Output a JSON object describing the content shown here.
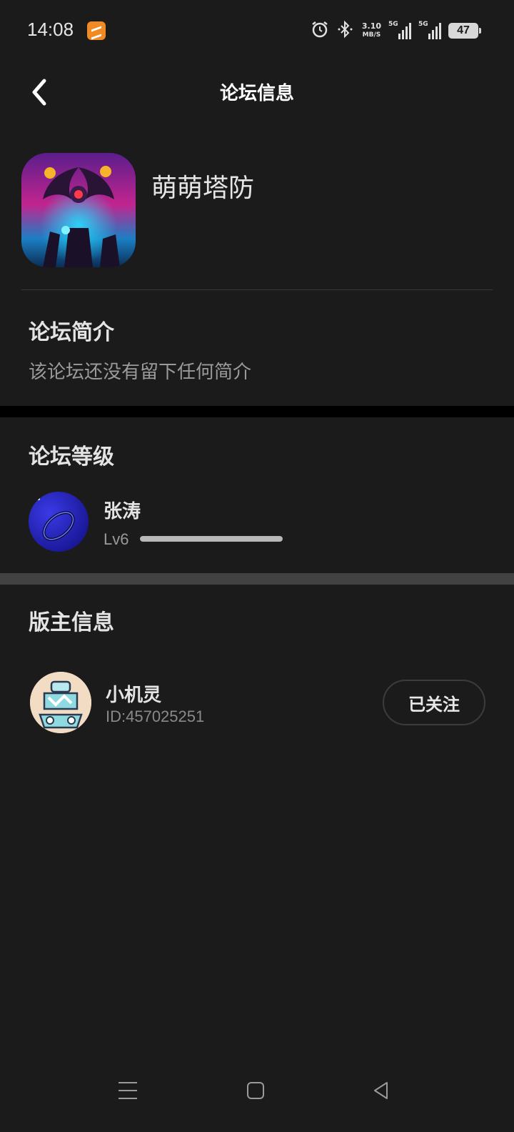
{
  "status_bar": {
    "time": "14:08",
    "net_speed_value": "3.10",
    "net_speed_unit": "MB/S",
    "sim1_label": "5G",
    "sim2_label": "5G",
    "battery": "47",
    "icons": [
      "app-notification-icon",
      "alarm-icon",
      "bluetooth-icon",
      "signal-icon",
      "signal-icon",
      "battery-icon"
    ]
  },
  "header": {
    "title": "论坛信息",
    "back_icon": "chevron-left-icon"
  },
  "forum": {
    "name": "萌萌塔防"
  },
  "intro": {
    "title": "论坛简介",
    "text": "该论坛还没有留下任何简介"
  },
  "level": {
    "title": "论坛等级",
    "user_name": "张涛",
    "level_label": "Lv6",
    "progress": 1.0
  },
  "moderator": {
    "title": "版主信息",
    "name": "小机灵",
    "id_text": "ID:457025251",
    "follow_label": "已关注"
  },
  "nav": {
    "icons": [
      "menu-icon",
      "home-icon",
      "back-triangle-icon"
    ]
  },
  "colors": {
    "background": "#1b1b1c",
    "divider_dark": "#000000",
    "divider_grey": "#424243",
    "text_primary": "#e4e4e4",
    "text_secondary": "#9a9a9a"
  }
}
